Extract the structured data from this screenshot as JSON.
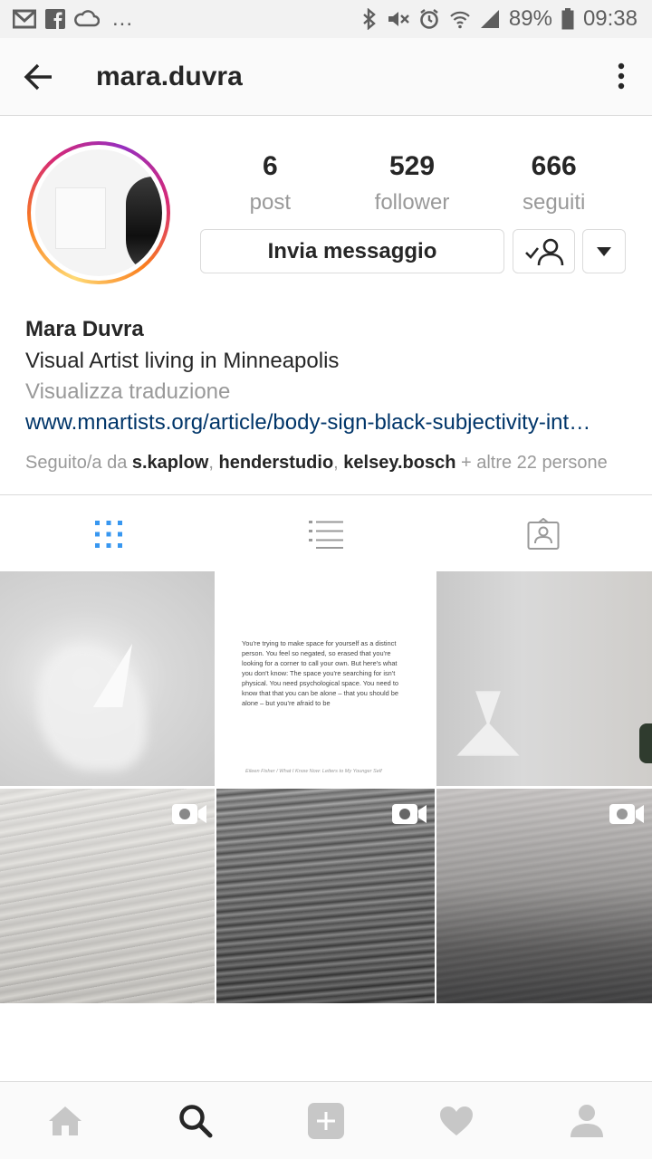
{
  "status_bar": {
    "battery": "89%",
    "time": "09:38",
    "overflow": "...",
    "left_icons": [
      "gmail-icon",
      "facebook-icon",
      "cloud-icon"
    ],
    "right_icons": [
      "bluetooth-icon",
      "mute-icon",
      "alarm-icon",
      "wifi-icon",
      "signal-icon",
      "battery-icon"
    ]
  },
  "header": {
    "title": "mara.duvra",
    "back_icon": "arrow-left-icon",
    "more_icon": "vertical-dots-icon"
  },
  "profile": {
    "stats": [
      {
        "value": "6",
        "label": "post"
      },
      {
        "value": "529",
        "label": "follower"
      },
      {
        "value": "666",
        "label": "seguiti"
      }
    ],
    "message_button": "Invia messaggio",
    "following_icon": "user-check-icon",
    "dropdown_icon": "caret-down-icon"
  },
  "bio": {
    "name": "Mara Duvra",
    "text": "Visual Artist living in Minneapolis",
    "translate": "Visualizza traduzione",
    "link": "www.mnartists.org/article/body-sign-black-subjectivity-int…",
    "followed_prefix": "Seguito/a da ",
    "followers": [
      "s.kaplow",
      "henderstudio",
      "kelsey.bosch"
    ],
    "separator": ", ",
    "followed_suffix": " + altre 22 persone"
  },
  "tabs": [
    {
      "name": "grid",
      "icon": "grid-icon",
      "active": true
    },
    {
      "name": "list",
      "icon": "list-icon",
      "active": false
    },
    {
      "name": "tagged",
      "icon": "tagged-icon",
      "active": false
    }
  ],
  "posts": {
    "quote_text": "You're trying to make space for yourself as a distinct person. You feel so negated, so erased that you're looking for a corner to call your own. But here's what you don't know: The space you're searching for isn't physical. You need psychological space. You need to know that that you can be alone – that you should be alone – but you're afraid to be",
    "quote_source": "Eileen Fisher / What I Know Now: Letters to My Younger Self",
    "video_icon": "video-camera-icon"
  },
  "bottom_nav": [
    {
      "name": "home",
      "icon": "home-icon"
    },
    {
      "name": "search",
      "icon": "search-icon",
      "active": true
    },
    {
      "name": "add",
      "icon": "add-icon"
    },
    {
      "name": "activity",
      "icon": "heart-icon"
    },
    {
      "name": "profile",
      "icon": "profile-icon"
    }
  ],
  "colors": {
    "accent_blue": "#3897f0",
    "link_blue": "#003569",
    "text": "#262626",
    "muted": "#999999",
    "border": "#dbdbdb"
  }
}
